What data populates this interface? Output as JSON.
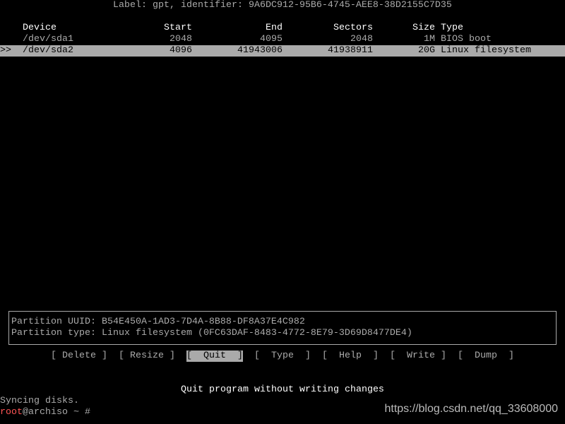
{
  "label_line": "Label: gpt, identifier: 9A6DC912-95B6-4745-AEE8-38D2155C7D35",
  "table": {
    "headers": {
      "device": "Device",
      "start": "Start",
      "end": "End",
      "sectors": "Sectors",
      "size": "Size",
      "type": "Type"
    },
    "rows": [
      {
        "marker": "",
        "device": "/dev/sda1",
        "start": "2048",
        "end": "4095",
        "sectors": "2048",
        "size": "1M",
        "type": "BIOS boot",
        "selected": false
      },
      {
        "marker": ">>",
        "device": "/dev/sda2",
        "start": "4096",
        "end": "41943006",
        "sectors": "41938911",
        "size": "20G",
        "type": "Linux filesystem",
        "selected": true
      }
    ]
  },
  "info": {
    "uuid_line": "Partition UUID: B54E450A-1AD3-7D4A-8B88-DF8A37E4C982",
    "type_line": "Partition type: Linux filesystem (0FC63DAF-8483-4772-8E79-3D69D8477DE4)"
  },
  "menu": [
    {
      "label": "[ Delete ]",
      "selected": false
    },
    {
      "label": "[ Resize ]",
      "selected": false
    },
    {
      "label": "[  Quit  ]",
      "selected": true
    },
    {
      "label": "[  Type  ]",
      "selected": false
    },
    {
      "label": "[  Help  ]",
      "selected": false
    },
    {
      "label": "[  Write ]",
      "selected": false
    },
    {
      "label": "[  Dump  ]",
      "selected": false
    }
  ],
  "hint": "Quit program without writing changes",
  "shell": {
    "line1": "Syncing disks.",
    "user": "root",
    "host_rest": "@archiso ~ #"
  },
  "watermark": "https://blog.csdn.net/qq_33608000"
}
